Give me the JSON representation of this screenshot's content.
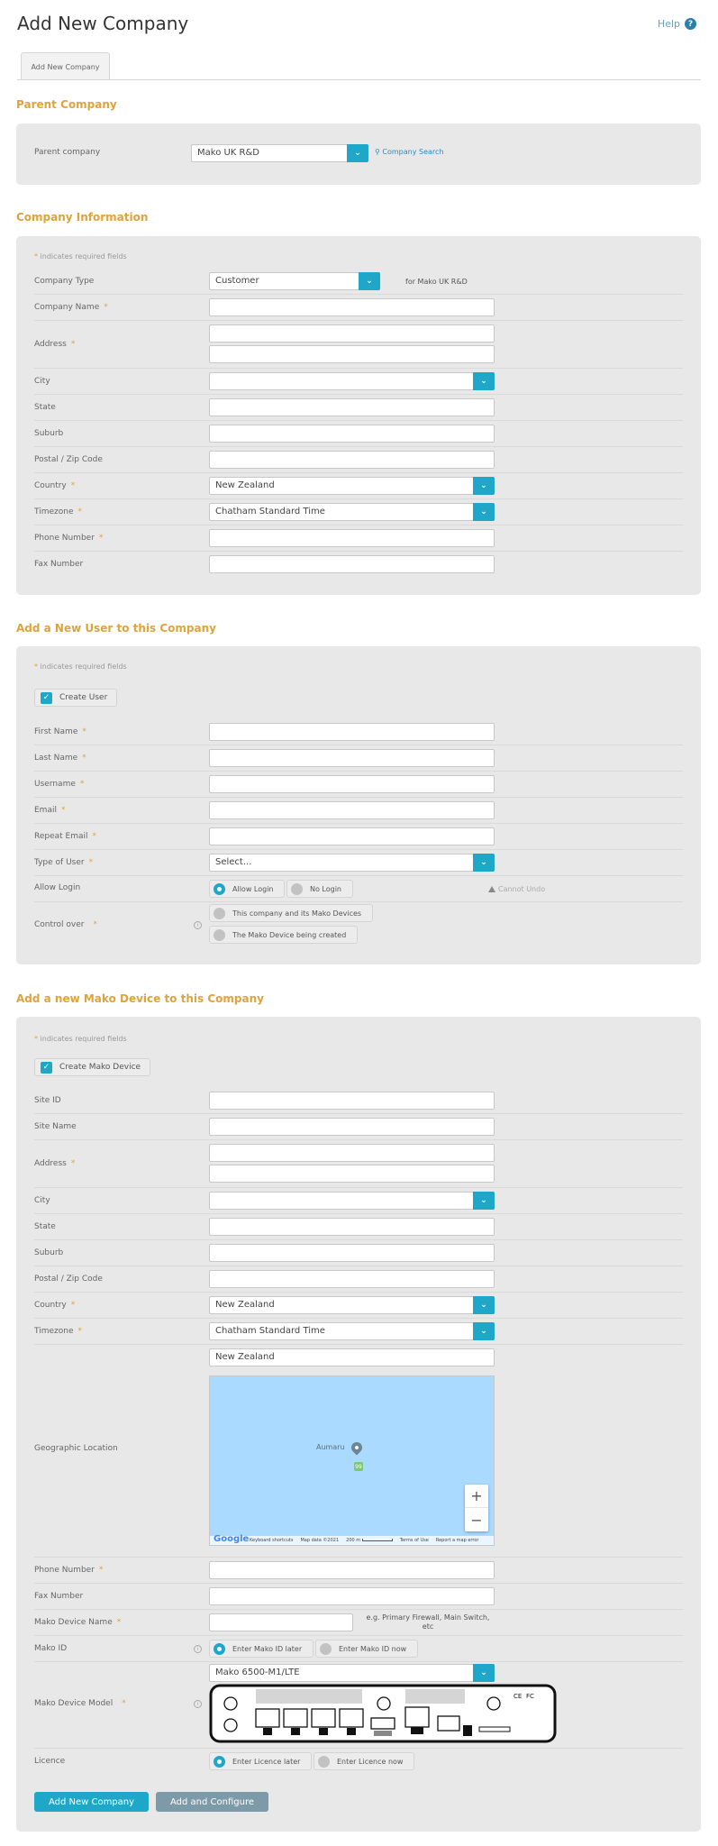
{
  "header": {
    "title": "Add New Company",
    "help_label": "Help"
  },
  "tabs": [
    {
      "label": "Add New Company"
    }
  ],
  "parent": {
    "section_title": "Parent Company",
    "label": "Parent company",
    "value": "Mako UK R&D",
    "search_link": "Company Search"
  },
  "company": {
    "section_title": "Company Information",
    "required_note": "indicates required fields",
    "type_label": "Company Type",
    "type_value": "Customer",
    "type_suffix": "for Mako UK R&D",
    "name_label": "Company Name",
    "address_label": "Address",
    "city_label": "City",
    "state_label": "State",
    "suburb_label": "Suburb",
    "postal_label": "Postal / Zip Code",
    "country_label": "Country",
    "country_value": "New Zealand",
    "timezone_label": "Timezone",
    "timezone_value": "Chatham Standard Time",
    "phone_label": "Phone Number",
    "fax_label": "Fax Number"
  },
  "user": {
    "section_title": "Add a New User to this Company",
    "required_note": "indicates required fields",
    "create_label": "Create User",
    "first_label": "First Name",
    "last_label": "Last Name",
    "username_label": "Username",
    "email_label": "Email",
    "repeat_email_label": "Repeat Email",
    "type_label": "Type of User",
    "type_value": "Select...",
    "allow_login_label": "Allow Login",
    "allow_login_yes": "Allow Login",
    "allow_login_no": "No Login",
    "cannot_undo": "Cannot Undo",
    "control_label": "Control over",
    "control_option_1": "This company and its Mako Devices",
    "control_option_2": "The Mako Device being created"
  },
  "device": {
    "section_title": "Add a new Mako Device to this Company",
    "required_note": "indicates required fields",
    "create_label": "Create Mako Device",
    "site_id_label": "Site ID",
    "site_name_label": "Site Name",
    "address_label": "Address",
    "city_label": "City",
    "state_label": "State",
    "suburb_label": "Suburb",
    "postal_label": "Postal / Zip Code",
    "country_label": "Country",
    "country_value": "New Zealand",
    "timezone_label": "Timezone",
    "timezone_value": "Chatham Standard Time",
    "geo_label": "Geographic Location",
    "geo_search_value": "New Zealand",
    "map": {
      "place_label": "Aumaru",
      "road_badge": "99",
      "zoom_in": "+",
      "zoom_out": "−",
      "logo": "Google",
      "footer_shortcuts": "Keyboard shortcuts",
      "footer_data": "Map data ©2021",
      "footer_scale": "200 m",
      "footer_terms": "Terms of Use",
      "footer_report": "Report a map error"
    },
    "phone_label": "Phone Number",
    "fax_label": "Fax Number",
    "mako_name_label": "Mako Device Name",
    "mako_name_hint": "e.g. Primary Firewall, Main Switch, etc",
    "mako_id_label": "Mako ID",
    "mako_id_later": "Enter Mako ID later",
    "mako_id_now": "Enter Mako ID now",
    "model_label": "Mako Device Model",
    "model_value": "Mako 6500-M1/LTE",
    "licence_label": "Licence",
    "licence_later": "Enter Licence later",
    "licence_now": "Enter Licence now"
  },
  "actions": {
    "add_label": "Add New Company",
    "configure_label": "Add and Configure"
  },
  "colors": {
    "accent": "#1ea7c9",
    "section_title": "#e0a33b",
    "panel": "#e8e8e8"
  }
}
